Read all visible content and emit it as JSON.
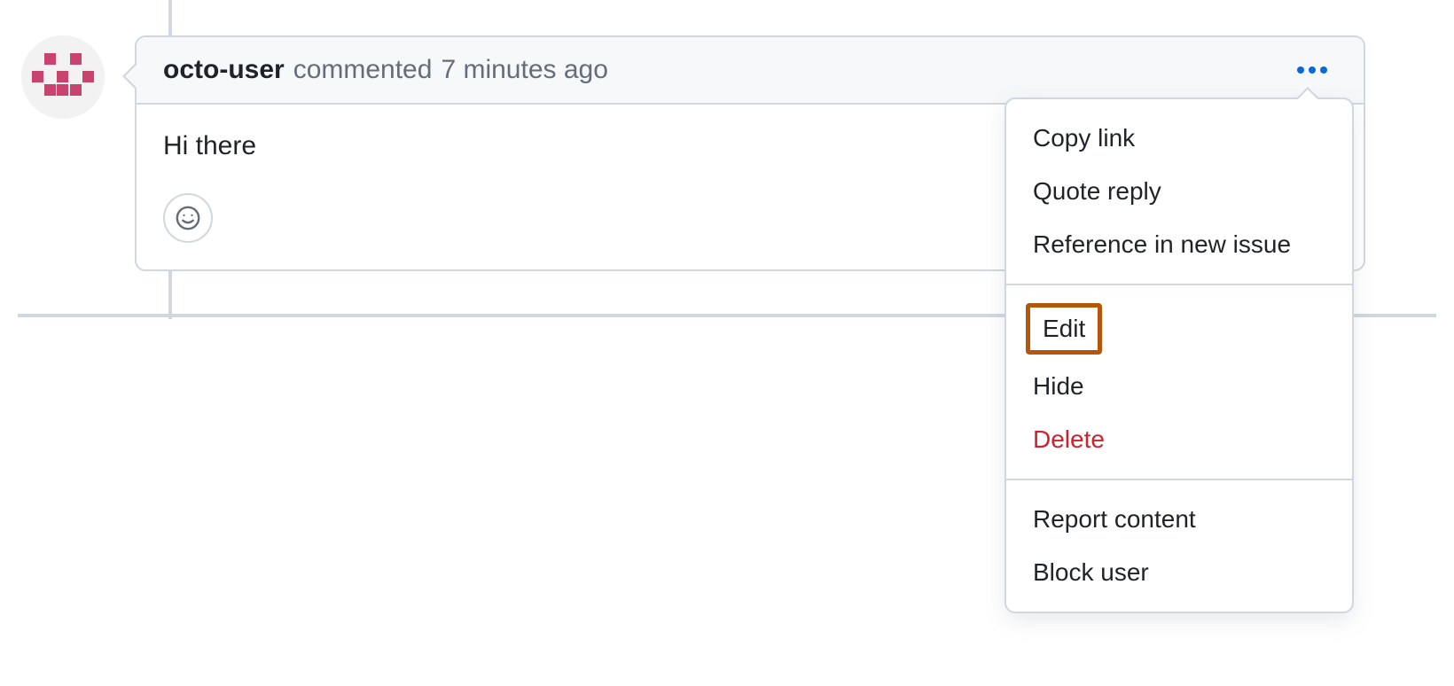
{
  "comment": {
    "author": "octo-user",
    "action_text": "commented",
    "timestamp": "7 minutes ago",
    "body": "Hi there"
  },
  "menu": {
    "group1": [
      {
        "label": "Copy link"
      },
      {
        "label": "Quote reply"
      },
      {
        "label": "Reference in new issue"
      }
    ],
    "group2": [
      {
        "label": "Edit",
        "highlighted": true
      },
      {
        "label": "Hide"
      },
      {
        "label": "Delete",
        "danger": true
      }
    ],
    "group3": [
      {
        "label": "Report content"
      },
      {
        "label": "Block user"
      }
    ]
  }
}
